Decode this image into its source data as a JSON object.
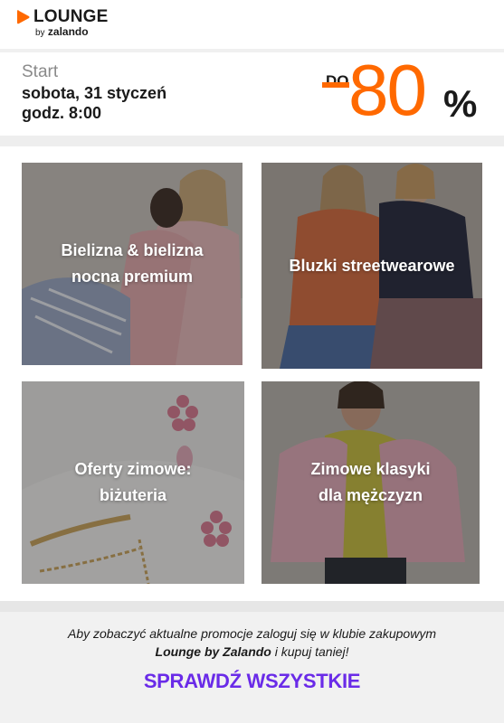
{
  "brand": {
    "name": "LOUNGE",
    "by": "by",
    "partner": "zalando",
    "accent": "#ff6900"
  },
  "promo": {
    "start_label": "Start",
    "date": "sobota, 31 styczeń",
    "time": "godz. 8:00",
    "do_label": "DO",
    "discount_value": "80",
    "percent_sign": "%"
  },
  "tiles": [
    {
      "line1": "Bielizna & bielizna",
      "line2": "nocna premium"
    },
    {
      "line1": "Bluzki streetwearowe",
      "line2": ""
    },
    {
      "line1": "Oferty zimowe:",
      "line2": "biżuteria"
    },
    {
      "line1": "Zimowe klasyki",
      "line2": "dla mężczyzn"
    }
  ],
  "footer": {
    "text_part1": "Aby zobaczyć aktualne promocje zaloguj się w klubie zakupowym",
    "text_brand": "Lounge by Zalando",
    "text_part2": " i kupuj taniej!",
    "cta_label": "SPRAWDŹ WSZYSTKIE",
    "cta_color": "#6a2be8"
  }
}
